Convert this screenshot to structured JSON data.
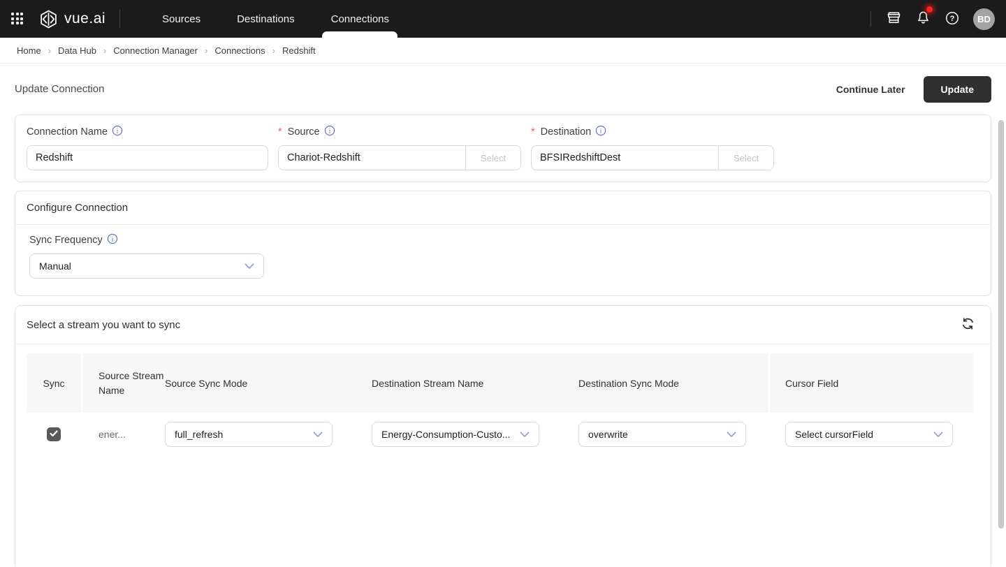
{
  "navbar": {
    "brand": "vue.ai",
    "items": [
      {
        "label": "Sources",
        "active": false
      },
      {
        "label": "Destinations",
        "active": false
      },
      {
        "label": "Connections",
        "active": true
      }
    ],
    "avatar_initials": "BD",
    "has_notification": true
  },
  "breadcrumb": {
    "separator": "›",
    "items": [
      "Home",
      "Data Hub",
      "Connection Manager",
      "Connections",
      "Redshift"
    ]
  },
  "page_header": {
    "title": "Update Connection",
    "continue_later_label": "Continue Later",
    "update_label": "Update"
  },
  "connection_form": {
    "required_marker": "*",
    "connection_name": {
      "label": "Connection Name",
      "value": "Redshift"
    },
    "source": {
      "label": "Source",
      "value": "Chariot-Redshift",
      "select_label": "Select"
    },
    "destination": {
      "label": "Destination",
      "value": "BFSIRedshiftDest",
      "select_label": "Select"
    }
  },
  "configure_connection": {
    "title": "Configure Connection",
    "sync_frequency": {
      "label": "Sync Frequency",
      "value": "Manual"
    }
  },
  "stream_section": {
    "title": "Select a stream you want to sync",
    "table": {
      "headers": [
        "Sync",
        "Source Stream Name",
        "Source Sync Mode",
        "Destination Stream Name",
        "Destination Sync Mode",
        "Cursor Field"
      ],
      "rows": [
        {
          "sync_checked": true,
          "source_stream_name": "ener...",
          "source_sync_mode": "full_refresh",
          "destination_stream_name": "Energy-Consumption-Custo...",
          "destination_sync_mode": "overwrite",
          "cursor_field": "Select cursorField"
        }
      ]
    }
  },
  "colors": {
    "navbar_bg": "#1b1b1b",
    "primary_button_bg": "#2f2f2f",
    "accent_indigo": "#5b67c7",
    "chevron_indigo": "#97a0d9",
    "required_red": "#e25c5c",
    "notification_red": "#ff2222",
    "table_header_bg": "#f7f7f7",
    "checkbox_bg": "#595959"
  }
}
